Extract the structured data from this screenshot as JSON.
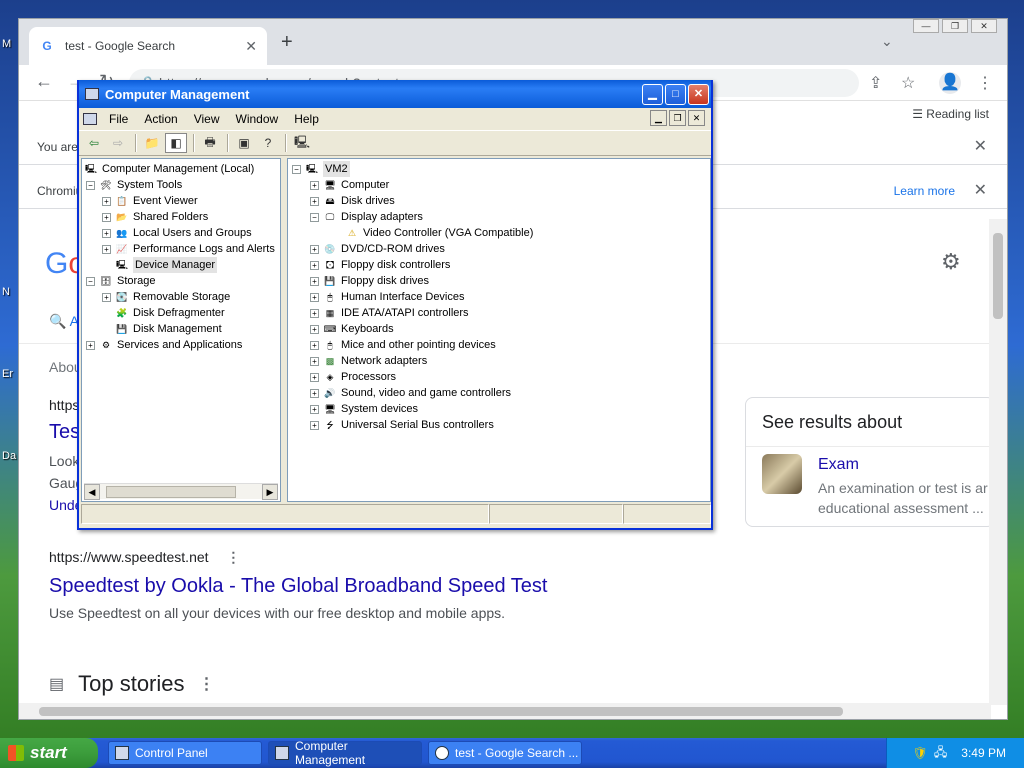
{
  "desktop": {
    "icon_labels": [
      "M",
      "N",
      "Er",
      "Da"
    ]
  },
  "chrome": {
    "tab_title": "test - Google Search",
    "url": "https://www.google.com/search?q=test",
    "reading_list": "Reading list",
    "infobar1_text": "You are",
    "infobar2_text": "Chromiu",
    "learn_more": "Learn more",
    "tab_label_partial": "A",
    "about_partial": "Abou",
    "result1": {
      "url_partial": "https",
      "title_partial": "Tes",
      "snippet_1": "Look",
      "snippet_2": "Gaug",
      "link_partial": "Unde"
    },
    "result2": {
      "url": "https://www.speedtest.net",
      "title": "Speedtest by Ookla - The Global Broadband Speed Test",
      "snippet": "Use Speedtest on all your devices with our free desktop and mobile apps."
    },
    "top_stories": "Top stories",
    "side_card": {
      "heading": "See results about",
      "item_title": "Exam",
      "item_desc_1": "An examination or test is ar",
      "item_desc_2": "educational assessment ..."
    }
  },
  "cm": {
    "title": "Computer Management",
    "menu": [
      "File",
      "Action",
      "View",
      "Window",
      "Help"
    ],
    "tree": [
      {
        "label": "Computer Management (Local)"
      },
      {
        "label": "System Tools"
      },
      {
        "label": "Event Viewer"
      },
      {
        "label": "Shared Folders"
      },
      {
        "label": "Local Users and Groups"
      },
      {
        "label": "Performance Logs and Alerts"
      },
      {
        "label": "Device Manager"
      },
      {
        "label": "Storage"
      },
      {
        "label": "Removable Storage"
      },
      {
        "label": "Disk Defragmenter"
      },
      {
        "label": "Disk Management"
      },
      {
        "label": "Services and Applications"
      }
    ],
    "devices": [
      {
        "label": "VM2"
      },
      {
        "label": "Computer"
      },
      {
        "label": "Disk drives"
      },
      {
        "label": "Display adapters"
      },
      {
        "label": "Video Controller (VGA Compatible)"
      },
      {
        "label": "DVD/CD-ROM drives"
      },
      {
        "label": "Floppy disk controllers"
      },
      {
        "label": "Floppy disk drives"
      },
      {
        "label": "Human Interface Devices"
      },
      {
        "label": "IDE ATA/ATAPI controllers"
      },
      {
        "label": "Keyboards"
      },
      {
        "label": "Mice and other pointing devices"
      },
      {
        "label": "Network adapters"
      },
      {
        "label": "Processors"
      },
      {
        "label": "Sound, video and game controllers"
      },
      {
        "label": "System devices"
      },
      {
        "label": "Universal Serial Bus controllers"
      }
    ]
  },
  "taskbar": {
    "start": "start",
    "items": [
      "Control Panel",
      "Computer Management",
      "test - Google Search ..."
    ],
    "clock": "3:49 PM"
  }
}
